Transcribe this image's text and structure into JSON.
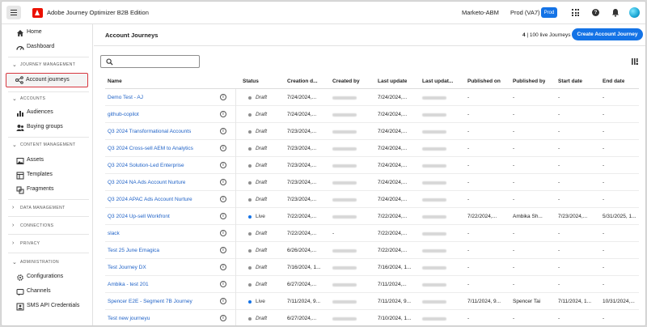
{
  "header": {
    "app_title": "Adobe Journey Optimizer B2B Edition",
    "org": "Marketo-ABM",
    "sandbox": "Prod (VA7)",
    "env_badge": "Prod"
  },
  "sidebar": {
    "items": [
      {
        "label": "Home",
        "icon": "home-icon"
      },
      {
        "label": "Dashboard",
        "icon": "dashboard-icon"
      }
    ],
    "sections": [
      {
        "title": "JOURNEY MANAGEMENT",
        "items": [
          {
            "label": "Account journeys",
            "icon": "account-journeys-icon",
            "selected": true
          }
        ]
      },
      {
        "title": "ACCOUNTS",
        "items": [
          {
            "label": "Audiences",
            "icon": "audiences-icon"
          },
          {
            "label": "Buying groups",
            "icon": "buying-groups-icon"
          }
        ]
      },
      {
        "title": "CONTENT MANAGEMENT",
        "items": [
          {
            "label": "Assets",
            "icon": "assets-icon"
          },
          {
            "label": "Templates",
            "icon": "templates-icon"
          },
          {
            "label": "Fragments",
            "icon": "fragments-icon"
          }
        ]
      },
      {
        "title": "DATA MANAGEMENT",
        "collapsed": true
      },
      {
        "title": "CONNECTIONS",
        "collapsed": true
      },
      {
        "title": "PRIVACY",
        "collapsed": true
      },
      {
        "title": "ADMINISTRATION",
        "items": [
          {
            "label": "Configurations",
            "icon": "configurations-icon"
          },
          {
            "label": "Channels",
            "icon": "channels-icon"
          },
          {
            "label": "SMS API Credentials",
            "icon": "sms-credentials-icon"
          }
        ]
      }
    ]
  },
  "main": {
    "title": "Account Journeys",
    "live_count_bold": "4",
    "live_count_text": "| 100 live Journeys",
    "create_button": "Create Account Journey",
    "search_placeholder": "",
    "columns": [
      "Name",
      "Status",
      "Creation d...",
      "Created by",
      "Last update",
      "Last updat...",
      "Published on",
      "Published by",
      "Start date",
      "End date"
    ],
    "rows": [
      {
        "name": "Demo Test - AJ",
        "status": "Draft",
        "creation": "7/24/2024,...",
        "created_by_blurred": true,
        "last_update": "7/24/2024,...",
        "last_updated_by_blurred": true,
        "published_on": "-",
        "published_by": "-",
        "start": "-",
        "end": "-"
      },
      {
        "name": "github-copilot",
        "status": "Draft",
        "creation": "7/24/2024,...",
        "created_by_blurred": true,
        "last_update": "7/24/2024,...",
        "last_updated_by_blurred": true,
        "published_on": "-",
        "published_by": "-",
        "start": "-",
        "end": "-"
      },
      {
        "name": "Q3 2024 Transformational Accounts",
        "status": "Draft",
        "creation": "7/23/2024,...",
        "created_by_blurred": true,
        "last_update": "7/24/2024,...",
        "last_updated_by_blurred": true,
        "published_on": "-",
        "published_by": "-",
        "start": "-",
        "end": "-"
      },
      {
        "name": "Q3 2024 Cross-sell AEM to Analytics",
        "status": "Draft",
        "creation": "7/23/2024,...",
        "created_by_blurred": true,
        "last_update": "7/24/2024,...",
        "last_updated_by_blurred": true,
        "published_on": "-",
        "published_by": "-",
        "start": "-",
        "end": "-"
      },
      {
        "name": "Q3 2024 Solution-Led Enterprise",
        "status": "Draft",
        "creation": "7/23/2024,...",
        "created_by_blurred": true,
        "last_update": "7/24/2024,...",
        "last_updated_by_blurred": true,
        "published_on": "-",
        "published_by": "-",
        "start": "-",
        "end": "-"
      },
      {
        "name": "Q3 2024 NA Ads Account Nurture",
        "status": "Draft",
        "creation": "7/23/2024,...",
        "created_by_blurred": true,
        "last_update": "7/24/2024,...",
        "last_updated_by_blurred": true,
        "published_on": "-",
        "published_by": "-",
        "start": "-",
        "end": "-"
      },
      {
        "name": "Q3 2024 APAC Ads Account Nurture",
        "status": "Draft",
        "creation": "7/23/2024,...",
        "created_by_blurred": true,
        "last_update": "7/24/2024,...",
        "last_updated_by_blurred": true,
        "published_on": "-",
        "published_by": "-",
        "start": "-",
        "end": "-"
      },
      {
        "name": "Q3 2024 Up-sell Workfront",
        "status": "Live",
        "creation": "7/22/2024,...",
        "created_by_blurred": true,
        "last_update": "7/22/2024,...",
        "last_updated_by_blurred": true,
        "published_on": "7/22/2024,...",
        "published_by": "Ambika Sh...",
        "start": "7/23/2024,...",
        "end": "5/31/2025, 1..."
      },
      {
        "name": "slack",
        "status": "Draft",
        "creation": "7/22/2024,...",
        "created_by_blurred": false,
        "created_by": "-",
        "last_update": "7/22/2024,...",
        "last_updated_by_blurred": true,
        "published_on": "-",
        "published_by": "-",
        "start": "-",
        "end": "-"
      },
      {
        "name": "Test 25 June Emagica",
        "status": "Draft",
        "creation": "6/26/2024,...",
        "created_by_blurred": true,
        "last_update": "7/22/2024,...",
        "last_updated_by_blurred": true,
        "published_on": "-",
        "published_by": "-",
        "start": "-",
        "end": "-"
      },
      {
        "name": "Test Journey DX",
        "status": "Draft",
        "creation": "7/16/2024, 1...",
        "created_by_blurred": true,
        "last_update": "7/16/2024, 1...",
        "last_updated_by_blurred": true,
        "published_on": "-",
        "published_by": "-",
        "start": "-",
        "end": "-"
      },
      {
        "name": "Ambika - test 201",
        "status": "Draft",
        "creation": "6/27/2024,...",
        "created_by_blurred": true,
        "last_update": "7/11/2024,...",
        "last_updated_by_blurred": true,
        "published_on": "-",
        "published_by": "-",
        "start": "-",
        "end": "-"
      },
      {
        "name": "Spencer E2E - Segment 7B Journey",
        "status": "Live",
        "creation": "7/11/2024, 9...",
        "created_by_blurred": true,
        "last_update": "7/11/2024, 9...",
        "last_updated_by_blurred": true,
        "published_on": "7/11/2024, 9...",
        "published_by": "Spencer Tai",
        "start": "7/11/2024, 1...",
        "end": "10/31/2024,..."
      },
      {
        "name": "Test new journeyu",
        "status": "Draft",
        "creation": "6/27/2024,...",
        "created_by_blurred": true,
        "last_update": "7/10/2024, 1...",
        "last_updated_by_blurred": true,
        "published_on": "-",
        "published_by": "-",
        "start": "-",
        "end": "-"
      }
    ]
  },
  "colors": {
    "accent": "#1473e6",
    "link": "#1f62c7",
    "draft_dot": "#8e8e8e",
    "live_dot": "#1473e6",
    "selection_outline": "#d7373f"
  }
}
